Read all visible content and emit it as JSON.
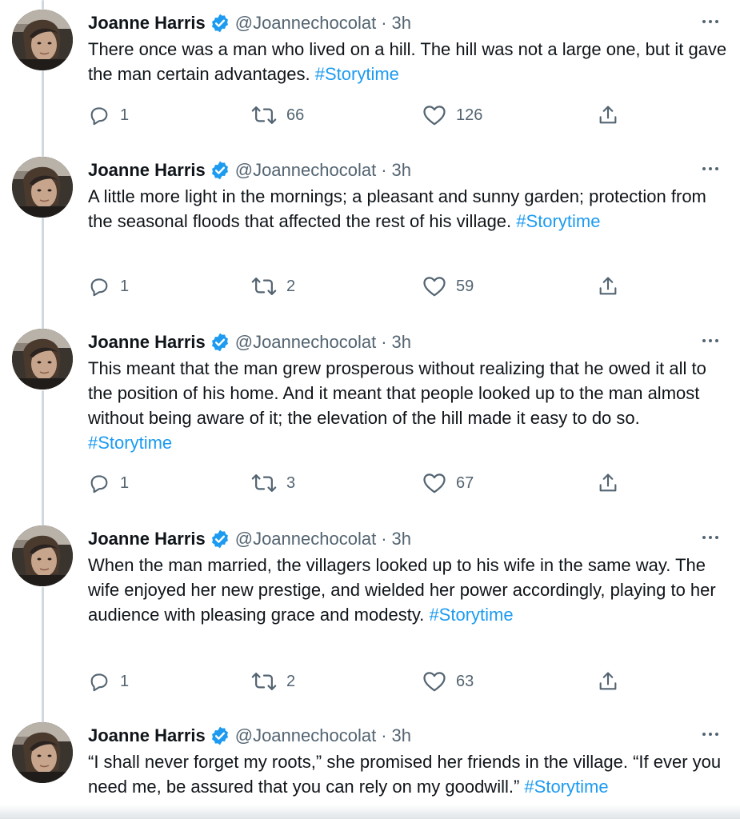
{
  "author": {
    "name": "Joanne Harris",
    "handle": "@Joannechocolat",
    "separator": "·",
    "time": "3h",
    "verified_color": "#1d9bf0"
  },
  "tweets": [
    {
      "text": "There once was a man who lived on a hill. The hill was not a large one, but it gave the man certain advantages.",
      "hashtag": "#Storytime",
      "replies": "1",
      "retweets": "66",
      "likes": "126"
    },
    {
      "text": "A little more light in the mornings; a pleasant and sunny garden; protection from the seasonal floods that affected the rest of his village.",
      "hashtag": "#Storytime",
      "replies": "1",
      "retweets": "2",
      "likes": "59"
    },
    {
      "text": "This meant that the man grew prosperous without realizing that he owed it all to the position of his home. And it meant that people looked up to the man almost without being aware of it; the elevation of the hill made it easy to do so.",
      "hashtag": "#Storytime",
      "replies": "1",
      "retweets": "3",
      "likes": "67"
    },
    {
      "text": "When the man married, the villagers looked up to his wife in the same way. The wife enjoyed her new prestige, and wielded her power accordingly, playing to her audience with pleasing grace and modesty.",
      "hashtag": "#Storytime",
      "replies": "1",
      "retweets": "2",
      "likes": "63"
    },
    {
      "text": "“I shall never forget my roots,” she promised her friends in the village. “If ever you need me, be assured that you can rely on my goodwill.”",
      "hashtag": "#Storytime"
    }
  ],
  "icons": {
    "reply": "reply-icon",
    "retweet": "retweet-icon",
    "like": "heart-icon",
    "share": "share-icon",
    "more": "more-icon",
    "verified": "verified-badge-icon"
  }
}
